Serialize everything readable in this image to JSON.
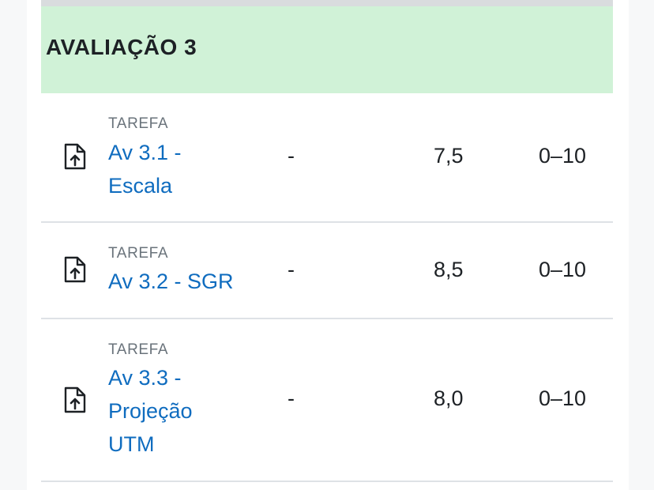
{
  "category": {
    "title": "AVALIAÇÃO 3"
  },
  "rows": [
    {
      "type": "TAREFA",
      "name": "Av 3.1 - Escala",
      "weight": "-",
      "grade": "7,5",
      "range": "0–10",
      "icon": "assignment-icon"
    },
    {
      "type": "TAREFA",
      "name": "Av 3.2 - SGR",
      "weight": "-",
      "grade": "8,5",
      "range": "0–10",
      "icon": "assignment-icon"
    },
    {
      "type": "TAREFA",
      "name": "Av 3.3 - Projeção UTM",
      "weight": "-",
      "grade": "8,0",
      "range": "0–10",
      "icon": "assignment-icon"
    }
  ],
  "colors": {
    "category_bg": "#d0f2d7",
    "link": "#0f6cbf",
    "muted": "#6a737b",
    "text": "#1d2125"
  }
}
